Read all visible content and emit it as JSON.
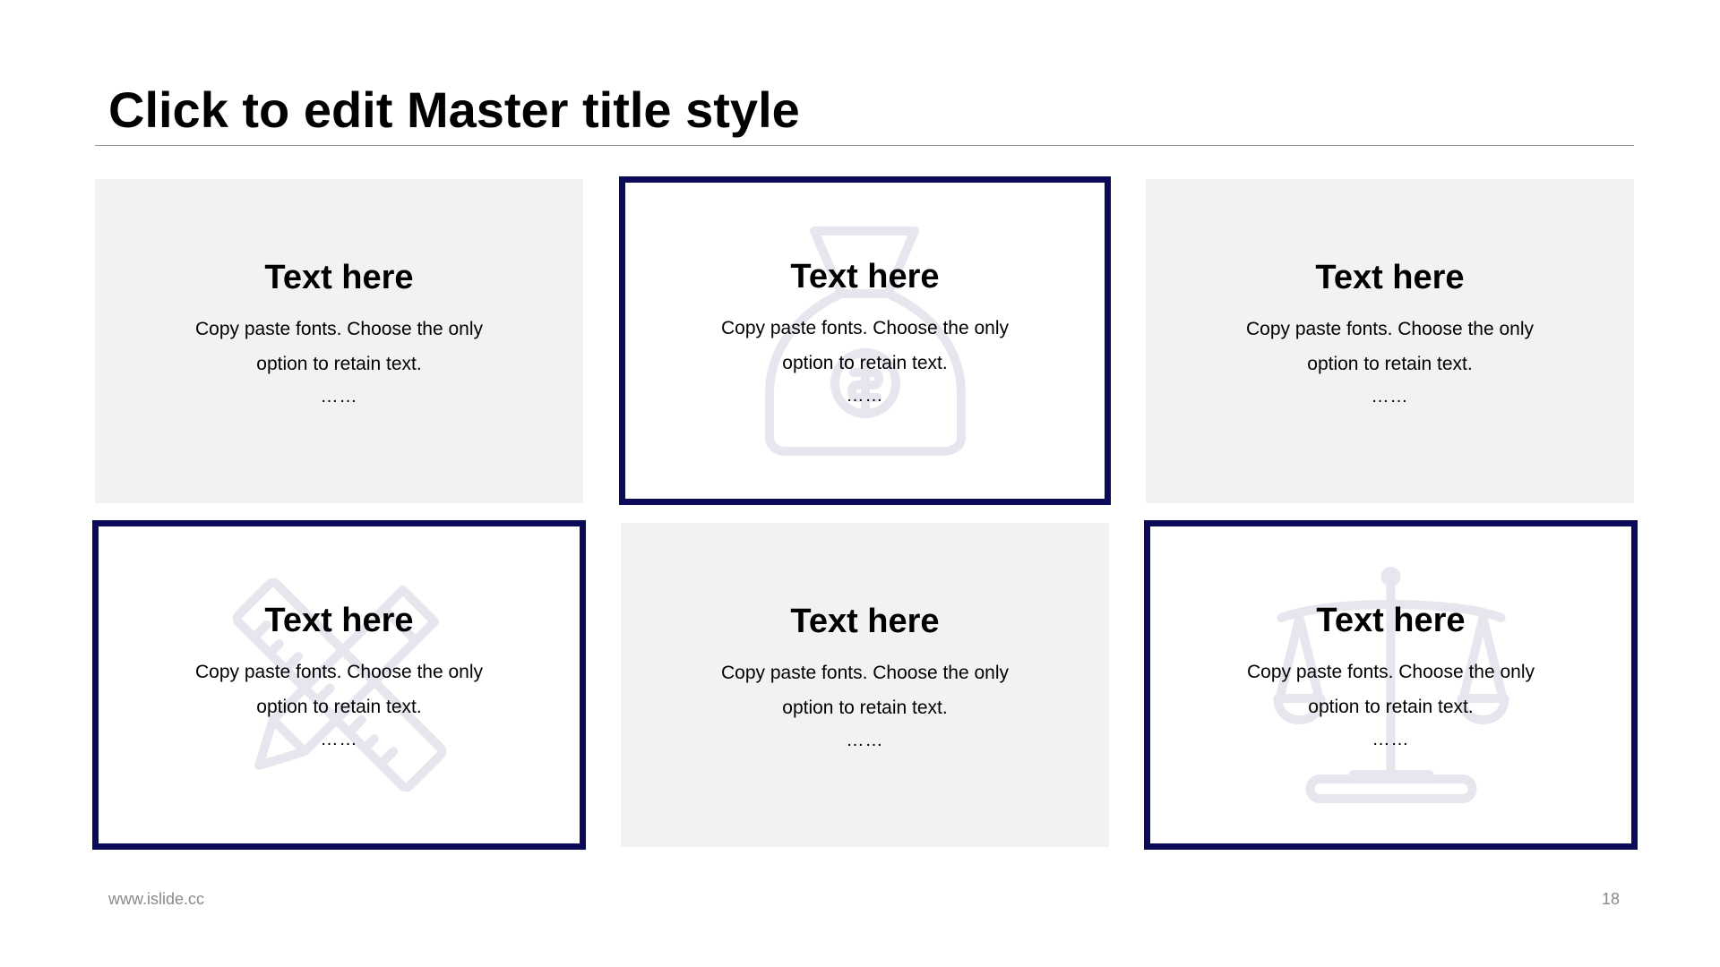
{
  "slide": {
    "title": "Click to edit Master title style",
    "footer_url": "www.islide.cc",
    "page_number": "18"
  },
  "colors": {
    "accent": "#0b0b5a",
    "card_fill": "#f2f2f2",
    "watermark": "#e6e6ef"
  },
  "cards": [
    {
      "heading": "Text here",
      "line1": "Copy paste fonts. Choose the only",
      "line2": "option to retain text.",
      "dots": "……",
      "style": "filled",
      "icon": ""
    },
    {
      "heading": "Text here",
      "line1": "Copy paste fonts. Choose the only",
      "line2": "option to retain text.",
      "dots": "……",
      "style": "outlined",
      "icon": "money-bag-icon"
    },
    {
      "heading": "Text here",
      "line1": "Copy paste fonts. Choose the only",
      "line2": "option to retain text.",
      "dots": "……",
      "style": "filled",
      "icon": ""
    },
    {
      "heading": "Text here",
      "line1": "Copy paste fonts. Choose the only",
      "line2": "option to retain text.",
      "dots": "……",
      "style": "outlined",
      "icon": "ruler-pencil-icon"
    },
    {
      "heading": "Text here",
      "line1": "Copy paste fonts. Choose the only",
      "line2": "option to retain text.",
      "dots": "……",
      "style": "filled",
      "icon": ""
    },
    {
      "heading": "Text here",
      "line1": "Copy paste fonts. Choose the only",
      "line2": "option to retain text.",
      "dots": "……",
      "style": "outlined",
      "icon": "balance-scale-icon"
    }
  ]
}
